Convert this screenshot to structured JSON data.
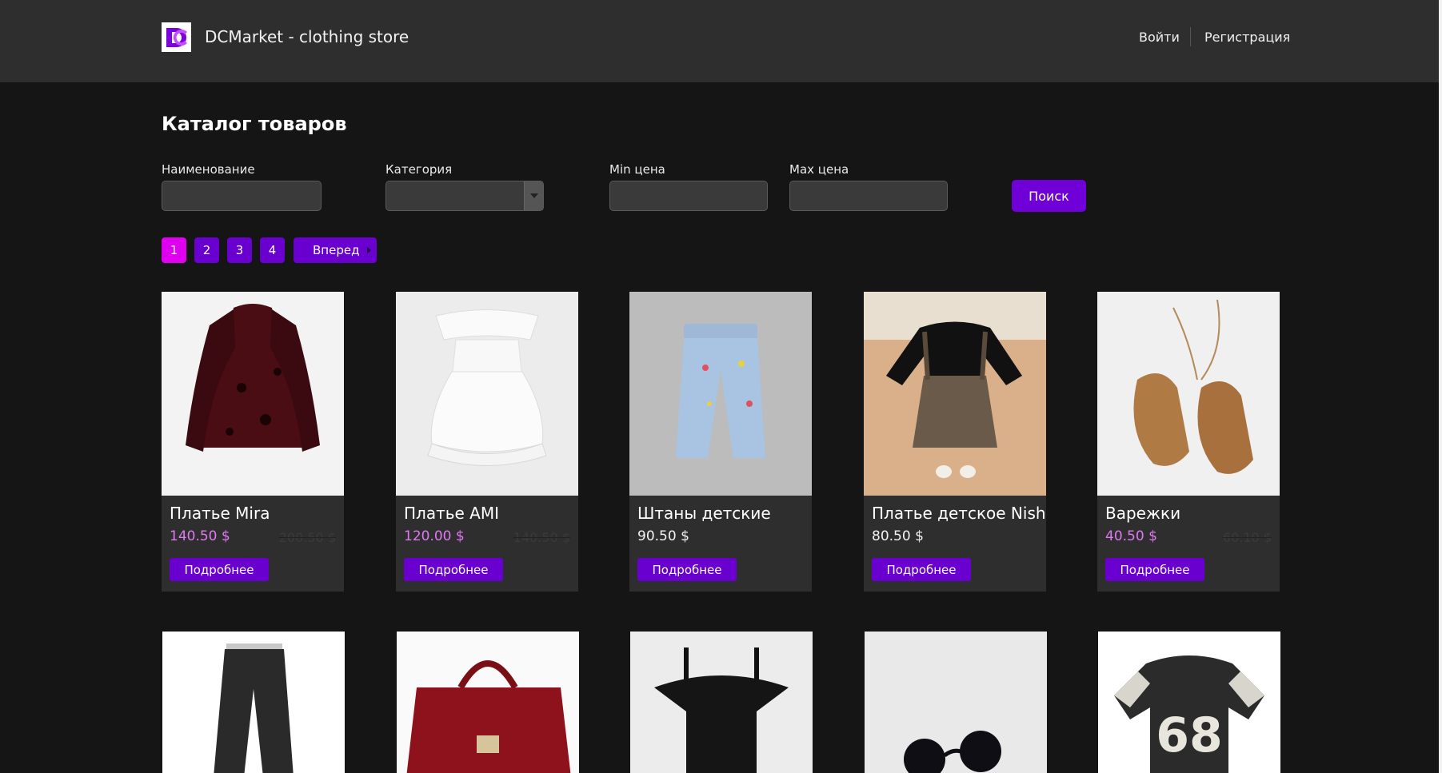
{
  "header": {
    "brand": "DCMarket - clothing store",
    "login": "Войти",
    "register": "Регистрация"
  },
  "catalog": {
    "title": "Каталог товаров",
    "filters": {
      "name_label": "Наименование",
      "category_label": "Категория",
      "min_label": "Min цена",
      "max_label": "Max цена",
      "search": "Поиск"
    },
    "pagination": {
      "pages": [
        "1",
        "2",
        "3",
        "4"
      ],
      "next": "Вперед",
      "current": "1"
    }
  },
  "products": [
    {
      "name": "Платье Mira",
      "price": "140.50 $",
      "old_price": "200.50 $",
      "on_sale": true,
      "button": "Подробнее"
    },
    {
      "name": "Платье AMI",
      "price": "120.00 $",
      "old_price": "140.50 $",
      "on_sale": true,
      "button": "Подробнее"
    },
    {
      "name": "Штаны детские",
      "price": "90.50 $",
      "old_price": "",
      "on_sale": false,
      "button": "Подробнее"
    },
    {
      "name": "Платье детское Nish",
      "price": "80.50 $",
      "old_price": "",
      "on_sale": false,
      "button": "Подробнее"
    },
    {
      "name": "Варежки",
      "price": "40.50 $",
      "old_price": "60.10 $",
      "on_sale": true,
      "button": "Подробнее"
    }
  ],
  "colors": {
    "accent": "#6a00cf",
    "active_page": "#e000f0",
    "sale_price": "#dd7af0",
    "background": "#151515",
    "header_bg": "#2e2e2e"
  }
}
